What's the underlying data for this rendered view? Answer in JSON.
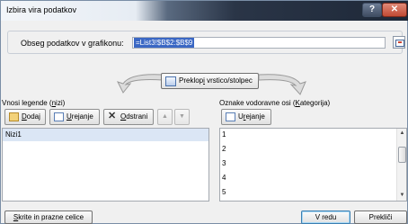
{
  "window": {
    "title": "Izbira vira podatkov",
    "help_glyph": "?",
    "close_glyph": "✕"
  },
  "range": {
    "label_pre": "Obseg podatkov v ",
    "label_hot": "g",
    "label_post": "rafikonu:",
    "value": "=List3!$B$2:$B$9"
  },
  "switch_button": {
    "pre": "Preklop",
    "hot": "i",
    "post": " vrstico/stolpec"
  },
  "legend": {
    "title_pre": "Vnosi legende (",
    "title_hot": "n",
    "title_post": "izi)",
    "add": {
      "hot": "D",
      "rest": "odaj"
    },
    "edit": {
      "hot": "U",
      "rest": "rejanje"
    },
    "remove": {
      "hot": "O",
      "rest": "dstrani"
    },
    "up_glyph": "▲",
    "down_glyph": "▼",
    "series": [
      "Nizi1"
    ]
  },
  "categories": {
    "title_pre": "Oznake vodoravne osi (",
    "title_hot": "K",
    "title_post": "ategorija)",
    "edit": {
      "pre": "U",
      "hot": "r",
      "rest": "ejanje"
    },
    "items": [
      "1",
      "2",
      "3",
      "4",
      "5"
    ]
  },
  "footer": {
    "hidden_cells": {
      "hot": "S",
      "rest": "krite in prazne celice"
    },
    "ok": "V redu",
    "cancel": "Prekliči"
  },
  "colors": {
    "selection": "#3a67c4",
    "list_selected": "#dbe6f5",
    "ok_border": "#3c7fb1"
  }
}
